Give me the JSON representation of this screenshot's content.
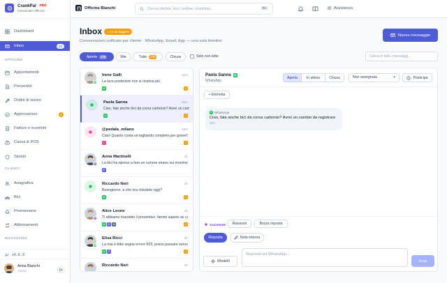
{
  "brand": {
    "name": "CrankPal",
    "badge": "PRO",
    "subtitle": "Gestionale Officina"
  },
  "topbar": {
    "shop": "Officina Bianchi",
    "search_placeholder": "Cerca cliente, bici, ordine, ricambio...",
    "shortcut": "⌘K",
    "assistant": "Assistenza"
  },
  "sidebar": {
    "top": [
      {
        "label": "Dashboard",
        "icon": "grid-icon"
      },
      {
        "label": "Inbox",
        "icon": "mail-icon",
        "badge": "12",
        "active": true
      }
    ],
    "sections": [
      {
        "label": "OFFICINA",
        "items": [
          {
            "label": "Appuntamenti",
            "icon": "calendar-icon"
          },
          {
            "label": "Preventivi",
            "icon": "document-icon"
          },
          {
            "label": "Ordini di lavoro",
            "icon": "wrench-icon"
          },
          {
            "label": "Approvazioni",
            "icon": "check-circle-icon",
            "badge": "3"
          },
          {
            "label": "Fatture e scontrini",
            "icon": "receipt-icon"
          },
          {
            "label": "Cassa & POS",
            "icon": "register-icon"
          },
          {
            "label": "Sinistri",
            "icon": "shield-icon"
          }
        ]
      },
      {
        "label": "CLIENTI",
        "items": [
          {
            "label": "Anagrafica",
            "icon": "users-icon"
          },
          {
            "label": "Bici",
            "icon": "bike-icon"
          },
          {
            "label": "Promemoria",
            "icon": "bell-icon"
          },
          {
            "label": "Abbonamenti",
            "icon": "repeat-icon"
          }
        ]
      },
      {
        "label": "MAGAZZINO",
        "items": []
      }
    ],
    "version": "v0.6.9",
    "user": {
      "name": "Anna Bianchi",
      "role": "Admin"
    }
  },
  "header": {
    "title": "Inbox",
    "badge": "+ 14 da leggere",
    "subtitle": "Conversazioni unificate per cliente · WhatsApp, Email, App — una sola timeline",
    "new_button": "Nuovo messaggio"
  },
  "filters": {
    "tabs": [
      {
        "label": "Aperte",
        "count": "245",
        "active": true
      },
      {
        "label": "Mie",
        "count": ""
      },
      {
        "label": "Tutte",
        "count": "245"
      },
      {
        "label": "Chiuse",
        "count": ""
      }
    ],
    "unread_label": "Solo non lette",
    "search_placeholder": "Cerca in tutti i messaggi..."
  },
  "conversations": [
    {
      "name": "Irene Galli",
      "time": "31m",
      "message": "La luce posteriore non si ricarica più",
      "channel": "W",
      "channel_color": "#22c55e",
      "tags": [
        {
          "t": "W",
          "c": "#22c55e"
        }
      ],
      "count": "1",
      "avatar": "photo",
      "avatar_color": "#b08d6e"
    },
    {
      "name": "Paola Sanna",
      "time": "32m",
      "message": "Ciao, fate anche bici da corsa carbonio? Avrei un cambio da registrare",
      "channel": "",
      "channel_color": "#22c55e",
      "tags": [
        {
          "t": "W",
          "c": "#22c55e"
        }
      ],
      "count": "1",
      "avatar": "dot",
      "avatar_color": "#22c55e",
      "selected": true
    },
    {
      "name": "@pedala_milano",
      "time": "32m",
      "message": "Ciao! Quanto costa un tagliando completo per gravel?",
      "channel": "",
      "channel_color": "#ec4899",
      "tags": [
        {
          "t": "I",
          "c": "#ec4899"
        }
      ],
      "count": "1",
      "avatar": "dot",
      "avatar_color": "#ec4899"
    },
    {
      "name": "Anna Martinelli",
      "time": "2h",
      "message": "La bici ha ripreso a fare un rumore strano sul movimento centrale",
      "channel": "E",
      "channel_color": "#6366f1",
      "tags": [
        {
          "t": "E",
          "c": "#6366f1"
        }
      ],
      "count": "",
      "avatar": "photo",
      "avatar_color": "#5a4636"
    },
    {
      "name": "Riccardo Neri",
      "time": "2h",
      "message": "Buongiorno, a che ora chiudete oggi?",
      "channel": "",
      "channel_color": "#22c55e",
      "tags": [
        {
          "t": "W",
          "c": "#22c55e"
        }
      ],
      "count": "1",
      "avatar": "dot",
      "avatar_color": "#22c55e"
    },
    {
      "name": "Alice Leone",
      "time": "2h",
      "message": "Ti abbiamo mandato il preventivo, fammi sapere se va bene",
      "channel": "E",
      "channel_color": "#6366f1",
      "tags": [
        {
          "t": "W",
          "c": "#22c55e"
        },
        {
          "t": "E",
          "c": "#6366f1"
        },
        {
          "t": "A",
          "c": "#64748b"
        }
      ],
      "count": "1",
      "avatar": "photo",
      "avatar_color": "#a98e74"
    },
    {
      "name": "Elisa Ricci",
      "time": "2h",
      "message": "La mia e-bike segna errore 503, posso passare senza appuntamento?",
      "channel": "W",
      "channel_color": "#22c55e",
      "tags": [
        {
          "t": "W",
          "c": "#22c55e"
        },
        {
          "t": "E",
          "c": "#6366f1"
        }
      ],
      "count": "1",
      "avatar": "photo",
      "avatar_color": "#4b3a2f"
    },
    {
      "name": "Riccardo Neri",
      "time": "3h",
      "message": "",
      "channel": "",
      "channel_color": "#22c55e",
      "tags": [],
      "count": "",
      "avatar": "photo",
      "avatar_color": "#8a6f58"
    }
  ],
  "detail": {
    "name": "Paola Sanna",
    "channel": "WhatsApp",
    "statuses": [
      "Aperta",
      "In attesa",
      "Chiusa"
    ],
    "assignee": "Non assegnata",
    "postpone": "Posticipa",
    "label_button": "+ Etichetta",
    "message": {
      "channel": "WhatsApp",
      "text": "Ciao, fate anche bici da corsa carbonio? Avrei un cambio da registrare",
      "time": "35m"
    },
    "ai_label": "Assistente",
    "ai_actions": [
      "Riassumi",
      "Bozza risposta"
    ],
    "reply_tabs": [
      "Risposta",
      "Nota interna"
    ],
    "templates": "Modelli",
    "reply_placeholder": "Rispondi via WhatsApp...",
    "send": "Invia"
  },
  "colors": {
    "accent": "#4f5bd5",
    "warning": "#f59e0b",
    "whatsapp": "#22c55e"
  }
}
